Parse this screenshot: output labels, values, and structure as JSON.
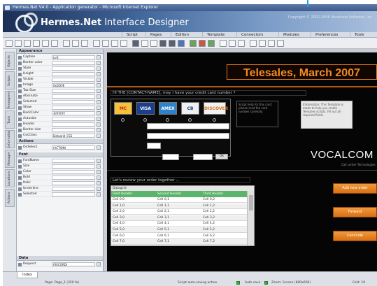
{
  "window": {
    "title": "Hermes.Net V4.0 - Application generator - Microsoft Internet Explorer"
  },
  "banner": {
    "app_name_bold": "Hermes.Net",
    "app_name_rest": " Interface Designer",
    "copyright": "Copyright © 2002-2006 Vocalcom Software, Inc."
  },
  "menu": {
    "items": [
      "Script",
      "Pages",
      "Edition",
      "Template",
      "Connectors",
      "Modules",
      "Preferences",
      "Tools"
    ]
  },
  "left_tabs": [
    "Objects",
    "Scripts",
    "Arrangements",
    "Tools",
    "Information",
    "Manager",
    "Locations",
    "Actions"
  ],
  "properties": {
    "sections": {
      "appearance": "Appearance",
      "actions": "Actions",
      "font": "Font",
      "data": "Data"
    },
    "appearance_rows": [
      {
        "name": "Caption",
        "value": "Left"
      },
      {
        "name": "Border color",
        "value": ""
      },
      {
        "name": "Style",
        "value": ""
      },
      {
        "name": "Height",
        "value": ""
      },
      {
        "name": "Visible",
        "value": ""
      },
      {
        "name": "Image",
        "value": "0xDOVE"
      },
      {
        "name": "Tab Size",
        "value": ""
      },
      {
        "name": "Alternate",
        "value": ""
      },
      {
        "name": "Selected",
        "value": ""
      },
      {
        "name": "Show",
        "value": ""
      },
      {
        "name": "BackColor",
        "value": "#FFFFFF"
      },
      {
        "name": "Autosize",
        "value": ""
      },
      {
        "name": "Header",
        "value": ""
      },
      {
        "name": "Border size",
        "value": ""
      },
      {
        "name": "CssClass",
        "value": "Datagrid_CSS"
      }
    ],
    "actions_rows": [
      {
        "name": "OnSelect",
        "value": "(ACTION)"
      }
    ],
    "font_rows": [
      {
        "name": "FontName",
        "value": ""
      },
      {
        "name": "Size",
        "value": ""
      },
      {
        "name": "Color",
        "value": ""
      },
      {
        "name": "Bold",
        "value": ""
      },
      {
        "name": "Italic",
        "value": ""
      },
      {
        "name": "Underline",
        "value": ""
      },
      {
        "name": "Selected",
        "value": ""
      }
    ],
    "data_rows": [
      {
        "name": "Request",
        "value": "(RECORD)"
      }
    ]
  },
  "canvas": {
    "title": "Telesales, March 2007",
    "question": "HI THE [CONTACT-NAME], may I have your credit card number ?",
    "cards": [
      {
        "label": "MC",
        "bg": "#f6c23a",
        "fg": "#c8241e"
      },
      {
        "label": "VISA",
        "bg": "#1b3f8f",
        "fg": "#ffffff"
      },
      {
        "label": "AMEX",
        "bg": "#2e82c9",
        "fg": "#ffffff"
      },
      {
        "label": "CB",
        "bg": "#f0f0f0",
        "fg": "#1b3f8f"
      },
      {
        "label": "DISCOVER",
        "bg": "#f2f2f2",
        "fg": "#d9731c"
      }
    ],
    "ok_label": "Ok",
    "help_text_1": "Script help for this card: please read the card number carefully.",
    "help_text_2": "Information: This Template is made to help you create Telesales scripts. Fill out all required fields.",
    "brand": "VOCALCOM",
    "brand_sub": "Call center Technologies",
    "review_text": "Let's review your order together ...",
    "grid": {
      "title": "Datagrid",
      "headers": [
        "Field Header",
        "Second Header",
        "Third Header"
      ],
      "rows": [
        [
          "Cell 0,0",
          "Cell 0,1",
          "Cell 0,2"
        ],
        [
          "Cell 1,0",
          "Cell 1,1",
          "Cell 1,2"
        ],
        [
          "Cell 2,0",
          "Cell 2,1",
          "Cell 2,2"
        ],
        [
          "Cell 3,0",
          "Cell 3,1",
          "Cell 3,2"
        ],
        [
          "Cell 4,0",
          "Cell 4,1",
          "Cell 4,2"
        ],
        [
          "Cell 5,0",
          "Cell 5,1",
          "Cell 5,2"
        ],
        [
          "Cell 6,0",
          "Cell 6,1",
          "Cell 6,2"
        ],
        [
          "Cell 7,0",
          "Cell 7,1",
          "Cell 7,2"
        ]
      ]
    },
    "buttons": [
      "Add new order",
      "Forward",
      "Conclude"
    ]
  },
  "status": {
    "tab_label": "Index",
    "left_text": "Page: Page_1 (350 fo)",
    "mid_text": "Script auto-saving active",
    "mid_text2": "Auto save",
    "right_text": "Zoom: Screen (800x600)",
    "far_right": "Grid: 10"
  },
  "colors": {
    "accent_orange": "#f08a24",
    "canvas_bg": "#050505",
    "grid_header": "#5ab56a"
  }
}
